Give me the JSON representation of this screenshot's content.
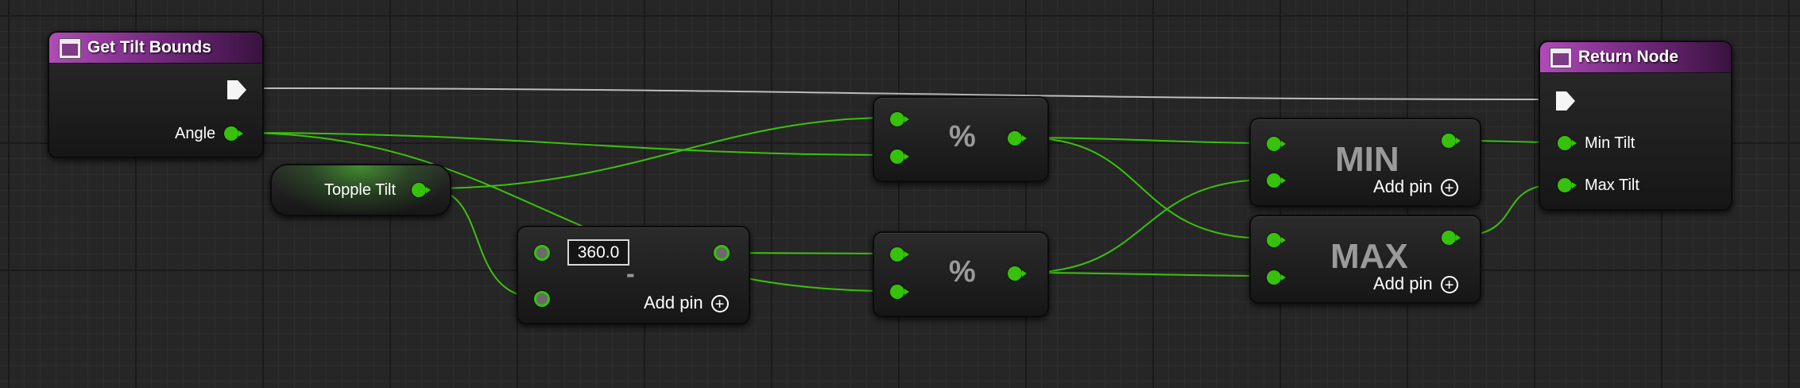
{
  "graph": {
    "entry_node": {
      "title": "Get Tilt Bounds",
      "output_pin": "Angle"
    },
    "variable_node": {
      "label": "Topple Tilt"
    },
    "subtract_node": {
      "operator": "-",
      "input_value": "360.0",
      "add_pin_label": "Add pin"
    },
    "modulo_node_top": {
      "operator": "%"
    },
    "modulo_node_bottom": {
      "operator": "%"
    },
    "min_node": {
      "operator": "MIN",
      "add_pin_label": "Add pin"
    },
    "max_node": {
      "operator": "MAX",
      "add_pin_label": "Add pin"
    },
    "return_node": {
      "title": "Return Node",
      "pins": [
        "Min Tilt",
        "Max Tilt"
      ]
    }
  },
  "colors": {
    "background": "#262626",
    "float_pin": "#36c20a",
    "function_header": "#7a2c85",
    "exec_wire": "#bdbdbd"
  }
}
